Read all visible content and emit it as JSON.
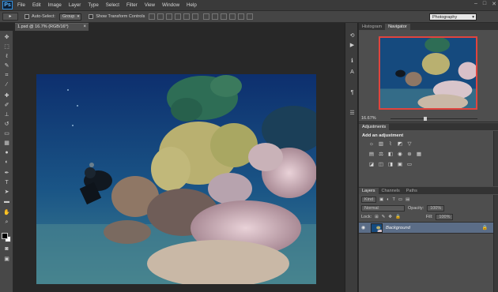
{
  "app": {
    "logo": "Ps"
  },
  "menu": [
    "File",
    "Edit",
    "Image",
    "Layer",
    "Type",
    "Select",
    "Filter",
    "View",
    "Window",
    "Help"
  ],
  "window_controls": {
    "minimize": "–",
    "restore": "□",
    "close": "✕"
  },
  "options": {
    "tool_glyph": "▸",
    "auto_select_label": "Auto-Select:",
    "auto_select_value": "Group",
    "transform_label": "Show Transform Controls",
    "workspace": "Photography"
  },
  "document": {
    "tab_label": "1.psd @ 16.7% (RGB/16*)",
    "close": "×"
  },
  "panels": {
    "top_tabs": [
      "Histogram",
      "Navigator"
    ],
    "zoom": "16.67%",
    "adjustments_tab": "Adjustments",
    "adjustments_title": "Add an adjustment",
    "layers_tabs": [
      "Layers",
      "Channels",
      "Paths"
    ],
    "kind_label": "Kind",
    "blend_mode": "Normal",
    "opacity_label": "Opacity:",
    "opacity_value": "100%",
    "lock_label": "Lock:",
    "fill_label": "Fill:",
    "fill_value": "100%",
    "layer_name": "Background"
  },
  "colors": {
    "accent_frame": "#e0443e",
    "selected_layer": "#5b6d87",
    "ps_blue": "#2f8fe0"
  },
  "icons": {
    "toolbox": [
      "move-icon",
      "marquee-icon",
      "lasso-icon",
      "quick-select-icon",
      "crop-icon",
      "eyedropper-icon",
      "healing-icon",
      "brush-icon",
      "clone-stamp-icon",
      "history-brush-icon",
      "eraser-icon",
      "gradient-icon",
      "blur-icon",
      "dodge-icon",
      "pen-icon",
      "type-icon",
      "path-select-icon",
      "shape-icon",
      "hand-icon",
      "zoom-icon"
    ],
    "dock": [
      "history-icon",
      "actions-icon",
      "info-icon",
      "character-icon",
      "paragraph-icon",
      "properties-icon"
    ]
  }
}
